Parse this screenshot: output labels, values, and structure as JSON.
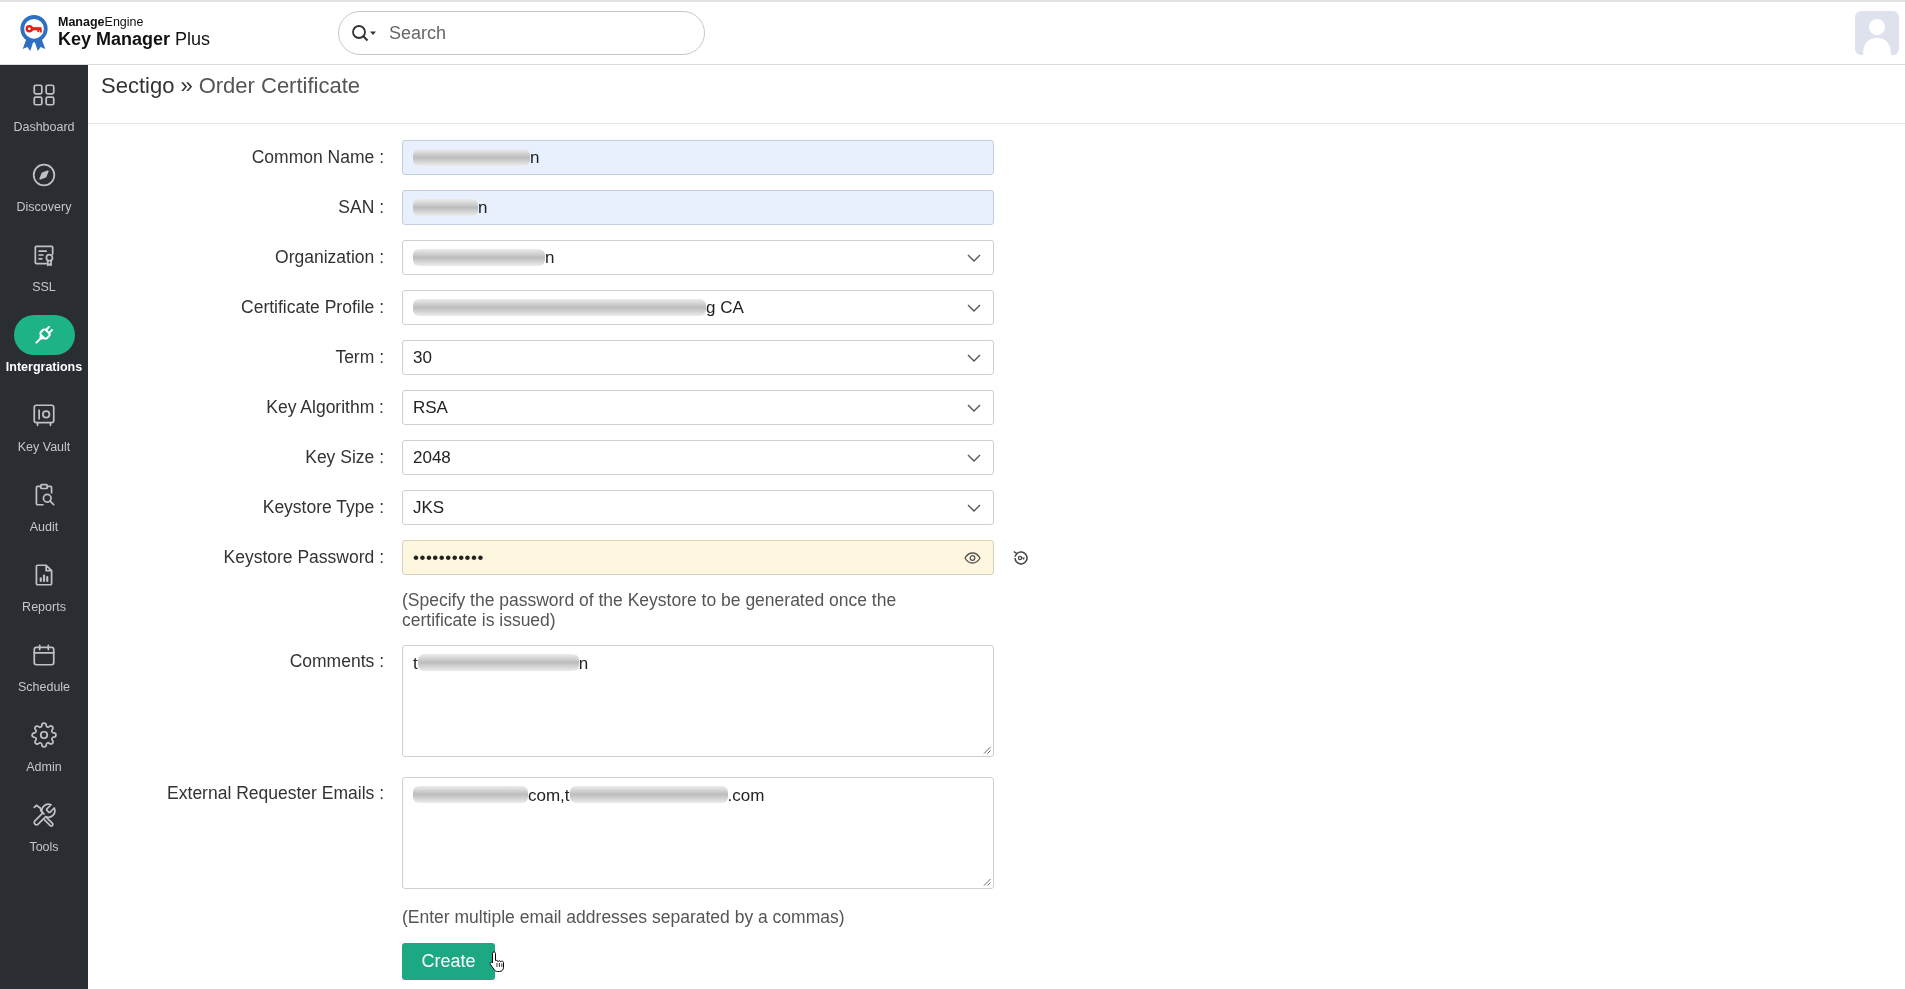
{
  "header": {
    "logo": {
      "brand": "**Manage**Engine",
      "product": "**Key Manager** Plus"
    },
    "search": {
      "placeholder": "Search"
    }
  },
  "sidebar": {
    "items": [
      {
        "label": "Dashboard",
        "selected": false
      },
      {
        "label": "Discovery",
        "selected": false
      },
      {
        "label": "SSL",
        "selected": false
      },
      {
        "label": "Intergrations",
        "selected": true
      },
      {
        "label": "Key Vault",
        "selected": false
      },
      {
        "label": "Audit",
        "selected": false
      },
      {
        "label": "Reports",
        "selected": false
      },
      {
        "label": "Schedule",
        "selected": false
      },
      {
        "label": "Admin",
        "selected": false
      },
      {
        "label": "Tools",
        "selected": false
      }
    ]
  },
  "breadcrumb": {
    "parent": "Sectigo",
    "separator": "»",
    "current": "Order Certificate"
  },
  "form": {
    "fields": [
      {
        "label": "Common Name :",
        "kind": "text",
        "autofilled": true,
        "value": [
          {
            "kind": "blurred"
          },
          {
            "kind": "text",
            "text": "n"
          }
        ]
      },
      {
        "label": "SAN :",
        "kind": "text",
        "autofilled": true,
        "value": [
          {
            "kind": "blurred"
          },
          {
            "kind": "text",
            "text": "n"
          }
        ]
      },
      {
        "label": "Organization :",
        "kind": "select",
        "value": [
          {
            "kind": "blurred"
          },
          {
            "kind": "text",
            "text": "n"
          }
        ]
      },
      {
        "label": "Certificate Profile :",
        "kind": "select",
        "value": [
          {
            "kind": "blurred"
          },
          {
            "kind": "text",
            "text": "g CA"
          }
        ]
      },
      {
        "label": "Term :",
        "kind": "select",
        "value": "30"
      },
      {
        "label": "Key Algorithm :",
        "kind": "select",
        "value": "RSA"
      },
      {
        "label": "Key Size :",
        "kind": "select",
        "value": "2048"
      },
      {
        "label": "Keystore Type :",
        "kind": "select",
        "value": "JKS"
      },
      {
        "label": "Keystore Password :",
        "kind": "password",
        "value": "•••••••••••",
        "hint": "(Specify the password of the Keystore to be generated once the certificate is issued)"
      },
      {
        "label": "Comments :",
        "kind": "textarea",
        "value": [
          {
            "kind": "text",
            "text": "t"
          },
          {
            "kind": "blurred"
          },
          {
            "kind": "text",
            "text": "n"
          }
        ]
      },
      {
        "label": "External Requester Emails :",
        "kind": "textarea",
        "value": [
          {
            "kind": "blurred"
          },
          {
            "kind": "text",
            "text": "com,t"
          },
          {
            "kind": "blurred"
          },
          {
            "kind": "text",
            "text": ".com"
          }
        ],
        "hint": "(Enter multiple email addresses separated by a commas)"
      }
    ],
    "submit": {
      "label": "Create"
    }
  }
}
